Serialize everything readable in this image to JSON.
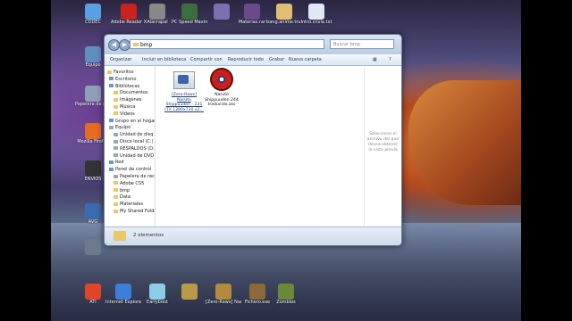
{
  "desktop_top_icons": [
    {
      "label": "CODEC",
      "color": "#5aa0e0"
    },
    {
      "label": "Adobe Reader X",
      "color": "#c8231d"
    },
    {
      "label": "Alacrapal",
      "color": "#888"
    },
    {
      "label": "PC Speed Maximizer",
      "color": "#3c6d3c"
    },
    {
      "label": "",
      "color": "#7b6fb0"
    },
    {
      "label": "Materias.rar",
      "color": "#6a4a8a"
    },
    {
      "label": "bang.anime.trul",
      "color": "#e0c070"
    },
    {
      "label": "Intro.cnvia.txt",
      "color": "#dfe8f3"
    }
  ],
  "desktop_left_icons": [
    {
      "label": "Equipo",
      "color": "#5f8fbf"
    },
    {
      "label": "Papelera de reciclaje",
      "color": "#8da0b8"
    },
    {
      "label": "Mozilla Firefox",
      "color": "#e86a1f"
    },
    {
      "label": "ENVIOS",
      "color": "#333"
    },
    {
      "label": "AVG",
      "color": "#3a6ab0"
    },
    {
      "label": "",
      "color": "#6c7a90"
    }
  ],
  "desktop_bottom_icons": [
    {
      "label": "ATI",
      "color": "#e0452a"
    },
    {
      "label": "Internet Explorer",
      "color": "#3b7fd6"
    },
    {
      "label": "Earlyboot",
      "color": "#8acde8"
    },
    {
      "label": "",
      "color": "#b99a47"
    },
    {
      "label": "[Zero-Raws] Naruto",
      "color": "#b48a3c"
    },
    {
      "label": "Fichero.exe",
      "color": "#8a6a3a"
    },
    {
      "label": "Zombies",
      "color": "#6a8a3a"
    }
  ],
  "explorer": {
    "address": "bmp",
    "search_placeholder": "Buscar bmp",
    "toolbar": {
      "organize": "Organizar",
      "include": "Incluir en biblioteca",
      "share": "Compartir con",
      "play": "Reproducir todo",
      "burn": "Grabar",
      "new_folder": "Nueva carpeta"
    },
    "nav_items": [
      {
        "label": "Favoritos",
        "type": "fav"
      },
      {
        "label": "Escritorio",
        "type": "b"
      },
      {
        "label": "Bibliotecas",
        "type": "b"
      },
      {
        "label": "Documentos",
        "type": "f"
      },
      {
        "label": "Imágenes",
        "type": "f"
      },
      {
        "label": "Música",
        "type": "f"
      },
      {
        "label": "Vídeos",
        "type": "f"
      },
      {
        "label": "Grupo en el hogar",
        "type": "b"
      },
      {
        "label": "Equipo",
        "type": "g"
      },
      {
        "label": "Unidad de disq",
        "type": "g"
      },
      {
        "label": "Disco local (C:)",
        "type": "g"
      },
      {
        "label": "RESPALDOS (D:)",
        "type": "g"
      },
      {
        "label": "Unidad de DVD",
        "type": "g"
      },
      {
        "label": "Red",
        "type": "b"
      },
      {
        "label": "Panel de control",
        "type": "b"
      },
      {
        "label": "Papelera de recic",
        "type": "g"
      },
      {
        "label": "Adobe CS5",
        "type": "f"
      },
      {
        "label": "bmp",
        "type": "f"
      },
      {
        "label": "Data",
        "type": "f"
      },
      {
        "label": "Materiales",
        "type": "f"
      },
      {
        "label": "My Shared Folder",
        "type": "f"
      }
    ],
    "files": [
      {
        "label": "[Zero-Raws] Naruto Shippuuden - 231 (TX 1280x720 x2...",
        "icon": "video-file-icon"
      },
      {
        "label": "Naruto Shippuuden 244 traducido.ass",
        "icon": "subtitle-file-icon"
      }
    ],
    "preview_text": "Seleccione el archivo del que desea obtener la vista previa",
    "status": "2 elementos"
  }
}
